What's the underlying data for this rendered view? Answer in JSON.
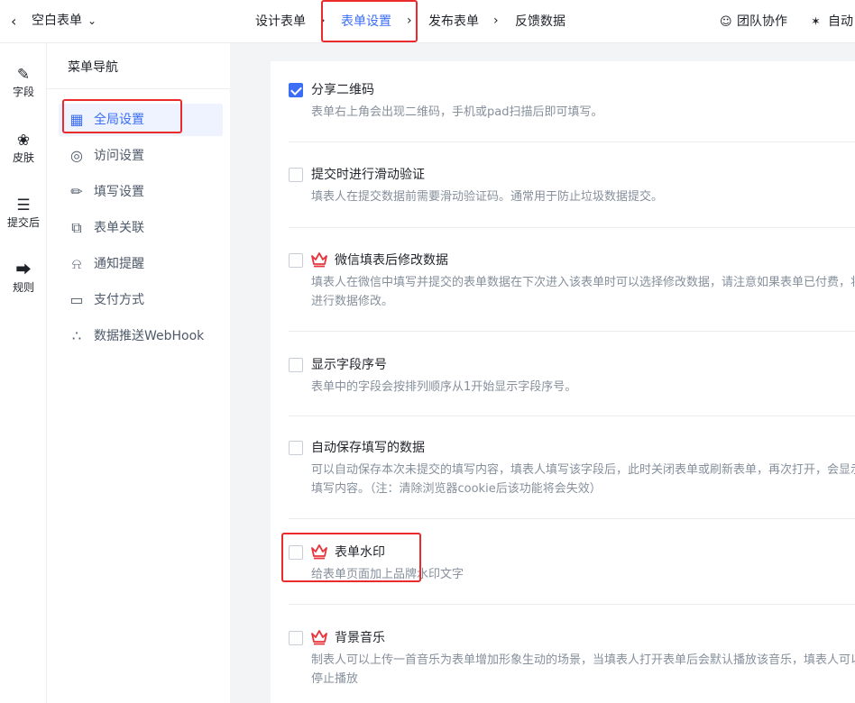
{
  "header": {
    "back_icon": "chevron-left-icon",
    "form_title": "空白表单",
    "title_caret_icon": "chevron-down-icon",
    "steps": [
      {
        "label": "设计表单",
        "active": false
      },
      {
        "label": "表单设置",
        "active": true
      },
      {
        "label": "发布表单",
        "active": false
      },
      {
        "label": "反馈数据",
        "active": false
      }
    ],
    "actions": [
      {
        "label": "团队协作",
        "icon": "team-icon"
      },
      {
        "label": "自动",
        "icon": "magic-wand-icon"
      }
    ]
  },
  "rail": {
    "items": [
      {
        "label": "字段",
        "icon": "edit-icon"
      },
      {
        "label": "皮肤",
        "icon": "palette-icon"
      },
      {
        "label": "提交后",
        "icon": "document-icon"
      },
      {
        "label": "规则",
        "icon": "flow-icon"
      }
    ]
  },
  "menu": {
    "heading": "菜单导航",
    "items": [
      {
        "label": "全局设置",
        "icon": "grid-icon",
        "active": true
      },
      {
        "label": "访问设置",
        "icon": "globe-icon",
        "active": false
      },
      {
        "label": "填写设置",
        "icon": "pencil-icon",
        "active": false
      },
      {
        "label": "表单关联",
        "icon": "link-squares-icon",
        "active": false
      },
      {
        "label": "通知提醒",
        "icon": "bell-icon",
        "active": false
      },
      {
        "label": "支付方式",
        "icon": "card-icon",
        "active": false
      },
      {
        "label": "数据推送WebHook",
        "icon": "chart-icon",
        "active": false
      }
    ]
  },
  "settings": [
    {
      "title": "分享二维码",
      "desc": "表单右上角会出现二维码，手机或pad扫描后即可填写。",
      "checked": true,
      "premium": false
    },
    {
      "title": "提交时进行滑动验证",
      "desc": "填表人在提交数据前需要滑动验证码。通常用于防止垃圾数据提交。",
      "checked": false,
      "premium": false
    },
    {
      "title": "微信填表后修改数据",
      "desc": "填表人在微信中填写并提交的表单数据在下次进入该表单时可以选择修改数据，请注意如果表单已付费，将不能进行数据修改。",
      "checked": false,
      "premium": true
    },
    {
      "title": "显示字段序号",
      "desc": "表单中的字段会按排列顺序从1开始显示字段序号。",
      "checked": false,
      "premium": false
    },
    {
      "title": "自动保存填写的数据",
      "desc": "可以自动保存本次未提交的填写内容，填表人填写该字段后，此时关闭表单或刷新表单，再次打开，会显示上次填写内容。（注：清除浏览器cookie后该功能将会失效）",
      "checked": false,
      "premium": false
    },
    {
      "title": "表单水印",
      "desc": "给表单页面加上品牌水印文字",
      "checked": false,
      "premium": true
    },
    {
      "title": "背景音乐",
      "desc": "制表人可以上传一首音乐为表单增加形象生动的场景，当填表人打开表单后会默认播放该音乐，填表人可以选择停止播放",
      "checked": false,
      "premium": true
    }
  ],
  "colors": {
    "accent": "#3b6ef5",
    "premium": "#e8343c",
    "annotation": "#ea2b2b"
  }
}
